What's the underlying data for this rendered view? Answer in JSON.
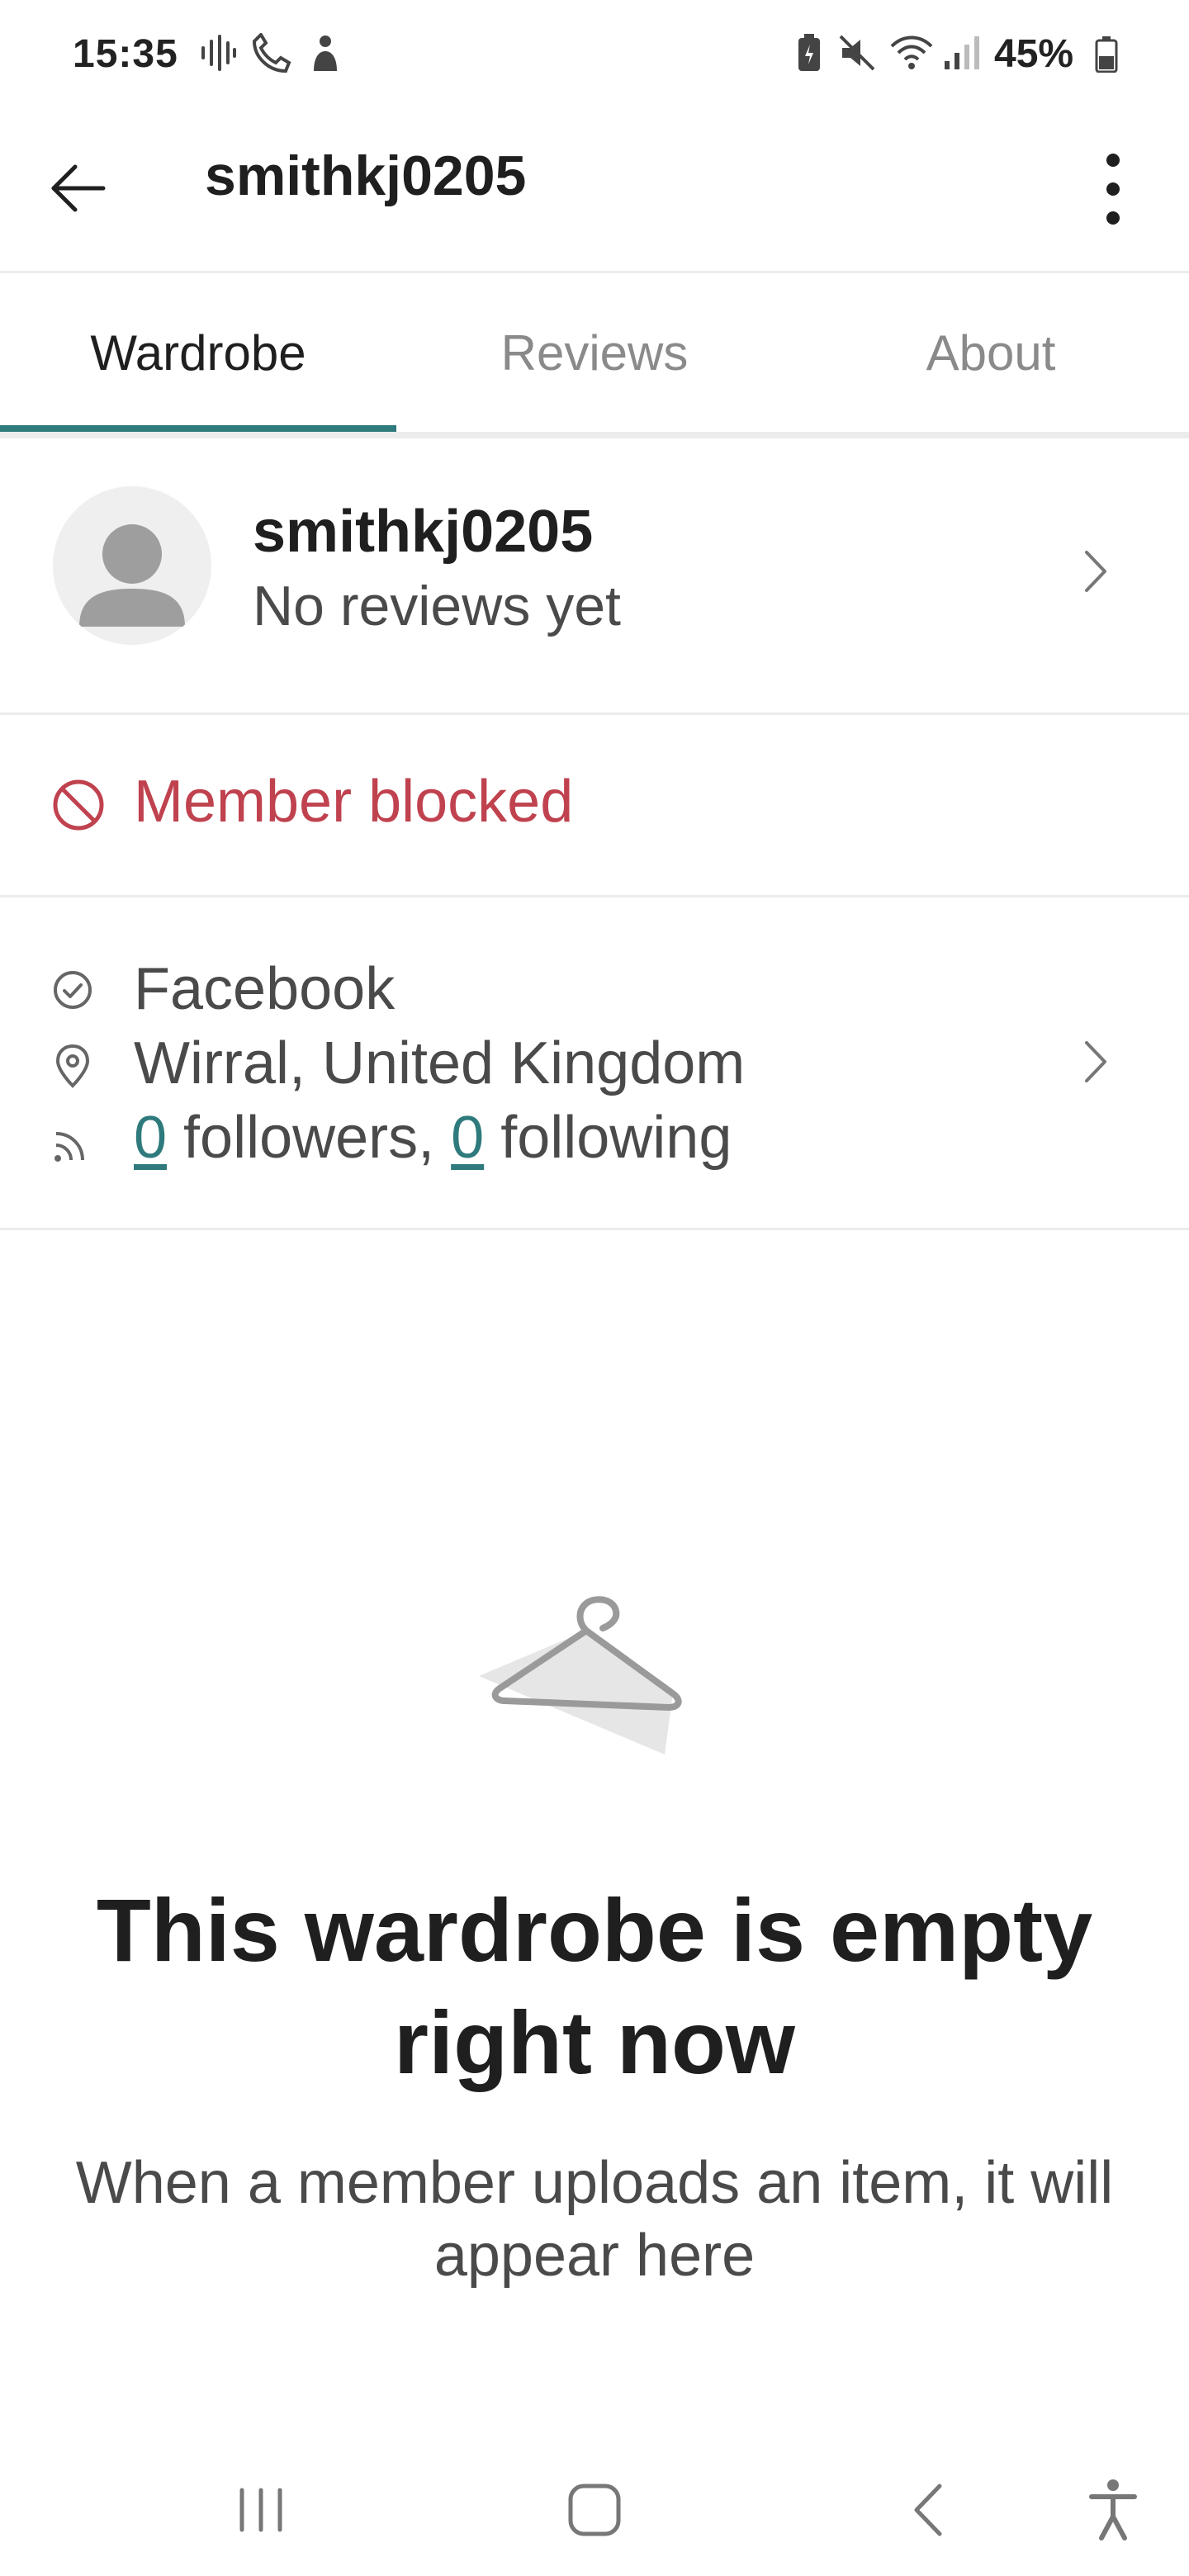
{
  "status_bar": {
    "time": "15:35",
    "battery_percent": "45%"
  },
  "app_bar": {
    "title": "smithkj0205",
    "back_icon": "arrow-left-icon",
    "menu_icon": "more-vertical-icon"
  },
  "tabs": [
    {
      "label": "Wardrobe",
      "active": true
    },
    {
      "label": "Reviews",
      "active": false
    },
    {
      "label": "About",
      "active": false
    }
  ],
  "profile": {
    "username": "smithkj0205",
    "reviews_text": "No reviews yet"
  },
  "blocked": {
    "label": "Member blocked",
    "color": "#c0424f"
  },
  "info": {
    "verified": "Facebook",
    "location": "Wirral, United Kingdom",
    "followers_count": "0",
    "followers_label": " followers, ",
    "following_count": "0",
    "following_label": " following"
  },
  "empty_state": {
    "title": "This wardrobe is empty right now",
    "description": "When a member uploads an item, it will appear here",
    "icon": "hanger-icon"
  },
  "colors": {
    "accent": "#2f7a7c",
    "danger": "#c0424f"
  }
}
